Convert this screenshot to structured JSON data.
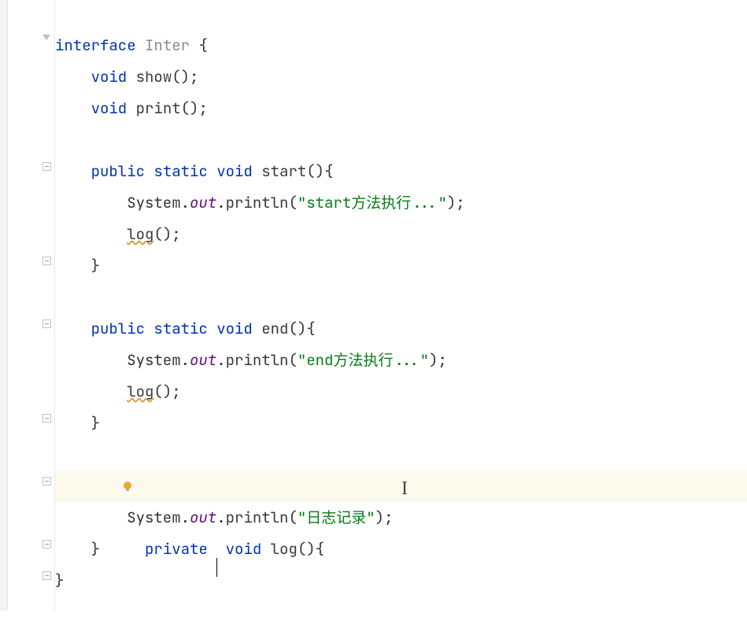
{
  "code": {
    "kw_interface": "interface",
    "class_name": "Inter",
    "kw_void": "void",
    "kw_public": "public",
    "kw_static": "static",
    "kw_private": "private",
    "method_show": "show",
    "method_print": "print",
    "method_start": "start",
    "method_end": "end",
    "method_log": "log",
    "system": "System",
    "out": "out",
    "println": "println",
    "str_start": "\"start方法执行...\"",
    "str_end": "\"end方法执行...\"",
    "str_log": "\"日志记录\"",
    "brace_open": "{",
    "brace_close": "}",
    "paren_open": "(",
    "paren_close": ")",
    "semi": ";",
    "dot": "."
  },
  "indent": {
    "l0": "",
    "l1": "    ",
    "l2": "        "
  },
  "colors": {
    "keyword": "#0033b3",
    "type_gray": "#8a8a8a",
    "string_green": "#067d17",
    "field_purple": "#660e7a",
    "highlight_bg": "#fcfaed",
    "bulb": "#f0a732"
  },
  "icons": {
    "fold_interface": "fold-triangle",
    "fold_method": "fold-minus",
    "intention_bulb": "bulb-icon"
  }
}
